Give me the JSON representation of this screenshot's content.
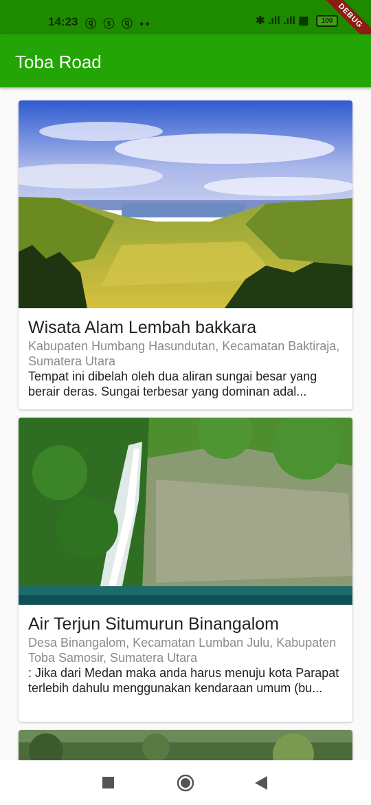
{
  "status": {
    "time": "14:23",
    "notification_icons": "ⓠ ⓢ ⓠ ••",
    "right_icons": "✱ .ıll .ıll ▩",
    "battery": "100",
    "debug_label": "DEBUG"
  },
  "app_bar": {
    "title": "Toba Road"
  },
  "places": [
    {
      "name": "Wisata Alam Lembah bakkara",
      "location": "Kabupaten Humbang Hasundutan, Kecamatan Baktiraja, Sumatera Utara",
      "description": "Tempat ini dibelah oleh dua aliran sungai besar yang berair deras. Sungai terbesar yang dominan adal..."
    },
    {
      "name": "Air Terjun Situmurun Binangalom",
      "location": "Desa Binangalom, Kecamatan Lumban Julu, Kabupaten Toba Samosir, Sumatera Utara",
      "description": ": Jika dari Medan maka anda harus menuju kota Parapat terlebih dahulu menggunakan kendaraan umum (bu..."
    }
  ],
  "nav": {
    "recents_icon": "square-icon",
    "home_icon": "circle-icon",
    "back_icon": "triangle-icon"
  }
}
